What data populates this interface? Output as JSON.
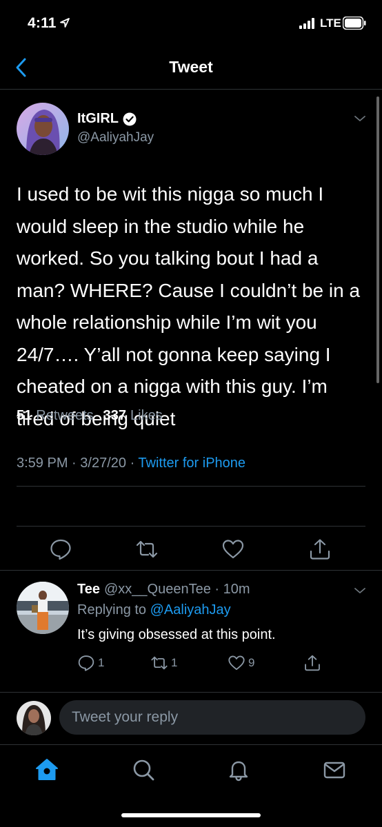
{
  "status_bar": {
    "time": "4:11",
    "network": "LTE"
  },
  "nav": {
    "title": "Tweet"
  },
  "tweet": {
    "author_name": "ItGIRL",
    "author_handle": "@AaliyahJay",
    "text": "I used to be wit this nigga so much I would sleep in the studio while he worked. So you talking bout I had a man? WHERE? Cause I couldn’t be in a whole relationship while I’m wit you 24/7…. Y’all not gonna keep saying I cheated on a nigga with this guy. I’m tired of being quiet",
    "time": "3:59 PM",
    "date": "3/27/20",
    "source": "Twitter for iPhone",
    "retweets": "51",
    "retweets_label": "Retweets",
    "likes": "337",
    "likes_label": "Likes"
  },
  "reply": {
    "name": "Tee",
    "handle": "@xx__QueenTee",
    "age": "10m",
    "replying_prefix": "Replying to",
    "replying_to": "@AaliyahJay",
    "text": "It’s giving obsessed at this point.",
    "reply_count": "1",
    "retweet_count": "1",
    "like_count": "9"
  },
  "composer": {
    "placeholder": "Tweet your reply"
  },
  "colors": {
    "accent": "#1d9bf0",
    "muted": "#8b98a5",
    "background": "#000000",
    "divider": "#2f3336"
  },
  "icons": {
    "nav": "chevron-left-icon",
    "actions": [
      "reply-icon",
      "retweet-icon",
      "heart-icon",
      "share-icon"
    ],
    "tabs": [
      "home-icon",
      "search-icon",
      "bell-icon",
      "mail-icon"
    ]
  }
}
